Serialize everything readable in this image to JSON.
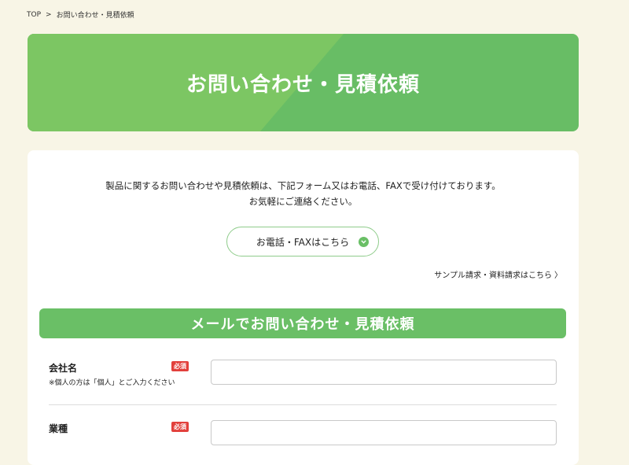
{
  "breadcrumb": {
    "home": "TOP",
    "separator": ">",
    "current": "お問い合わせ・見積依頼"
  },
  "hero": {
    "title": "お問い合わせ・見積依頼"
  },
  "intro": {
    "line1": "製品に関するお問い合わせや見積依頼は、下記フォーム又はお電話、FAXで受け付けております。",
    "line2": "お気軽にご連絡ください。"
  },
  "phone_button": {
    "label": "お電話・FAXはこちら",
    "icon": "chevron-down-icon"
  },
  "sample_link": {
    "label": "サンプル請求・資料請求はこちら",
    "icon": "chevron-right-icon"
  },
  "form": {
    "section_title": "メールでお問い合わせ・見積依頼",
    "fields": [
      {
        "label": "会社名",
        "badge": "必須",
        "note": "※個人の方は「個人」とご入力ください",
        "value": ""
      },
      {
        "label": "業種",
        "badge": "必須",
        "value": ""
      }
    ]
  },
  "colors": {
    "page_bg": "#f8f5e6",
    "accent_green": "#6abf66",
    "required_red": "#e2403c"
  }
}
